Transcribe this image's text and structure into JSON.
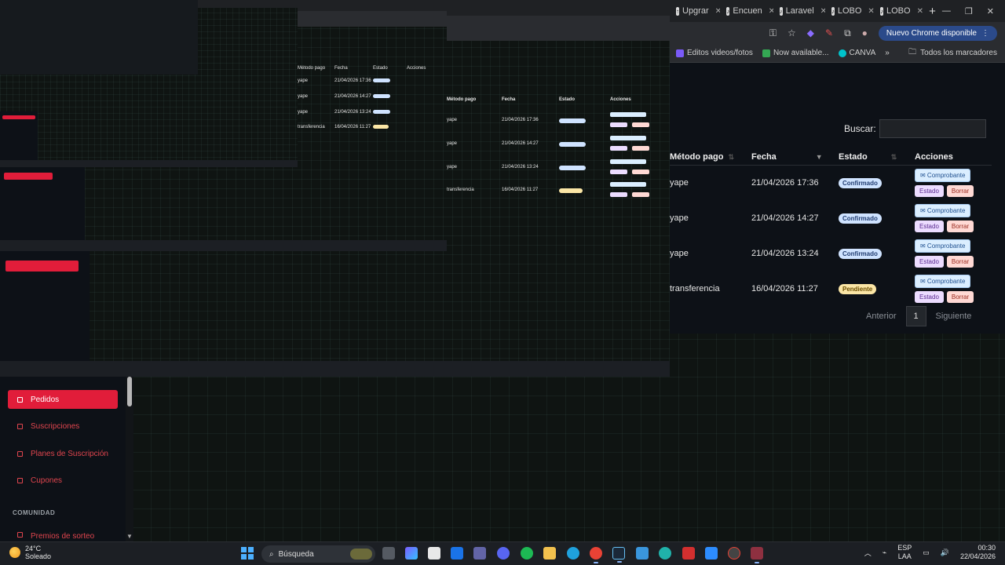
{
  "browser": {
    "tabs": [
      {
        "label": "Upgrar",
        "icon": "upgrade-favicon"
      },
      {
        "label": "Encuen",
        "icon": "tiktok-favicon"
      },
      {
        "label": "Laravel",
        "icon": "tiktok-favicon"
      },
      {
        "label": "LOBO",
        "icon": "tiktok-favicon"
      },
      {
        "label": "LOBO",
        "icon": "tiktok-favicon"
      }
    ],
    "new_tab": "+",
    "update_button": "Nuevo Chrome disponible",
    "bookmarks": [
      {
        "label": "Editos videos/fotos",
        "color": "#7a5af8"
      },
      {
        "label": "Now available...",
        "color": "#34a853"
      },
      {
        "label": "CANVA",
        "color": "#00c4cc"
      }
    ],
    "bookmarks_overflow": "»",
    "all_bookmarks": "Todos los marcadores"
  },
  "orders": {
    "search_label": "Buscar:",
    "columns": [
      "Método pago",
      "Fecha",
      "Estado",
      "Acciones"
    ],
    "rows": [
      {
        "method": "yape",
        "date": "21/04/2026 17:36",
        "status": "Confirmado",
        "status_type": "ok"
      },
      {
        "method": "yape",
        "date": "21/04/2026 14:27",
        "status": "Confirmado",
        "status_type": "ok"
      },
      {
        "method": "yape",
        "date": "21/04/2026 13:24",
        "status": "Confirmado",
        "status_type": "ok"
      },
      {
        "method": "transferencia",
        "date": "16/04/2026 11:27",
        "status": "Pendiente",
        "status_type": "pend"
      }
    ],
    "actions": {
      "receipt": "✉ Comprobante",
      "status": "Estado",
      "delete": "Borrar"
    },
    "pager": {
      "prev": "Anterior",
      "page": "1",
      "next": "Siguiente"
    }
  },
  "sidebar": {
    "items": [
      {
        "label": "Pedidos",
        "active": true
      },
      {
        "label": "Suscripciones",
        "active": false
      },
      {
        "label": "Planes de Suscripción",
        "active": false
      },
      {
        "label": "Cupones",
        "active": false
      }
    ],
    "section": "COMUNIDAD",
    "partial_item": "Premios de sorteo"
  },
  "taskbar": {
    "weather_temp": "24°C",
    "weather_text": "Soleado",
    "search": "Búsqueda",
    "lang_top": "ESP",
    "lang_bottom": "LAA",
    "time": "00:30",
    "date": "22/04/2026"
  }
}
